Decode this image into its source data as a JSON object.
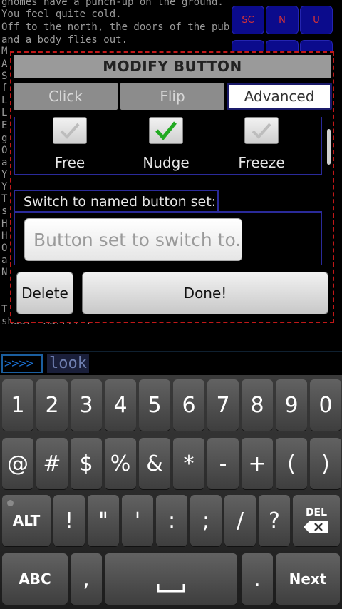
{
  "terminal": {
    "lines": [
      "gnomes have a punch-up on the ground.",
      "You feel quite cold.",
      "Off to the north, the doors of the pub open",
      "and a body flies out.",
      "M",
      "A",
      "S",
      "f",
      "L",
      "L",
      "E",
      "g",
      "O",
      "a",
      "Y",
      "Y",
      "T",
      "s",
      "H",
      "H",
      "O",
      "a",
      "N",
      "",
      "T",
      "shout \"Aarrr!\"."
    ]
  },
  "mini_buttons": {
    "sc": "SC",
    "n": "N",
    "u": "U"
  },
  "dialog": {
    "title": "MODIFY BUTTON",
    "tabs": [
      {
        "label": "Click",
        "active": false
      },
      {
        "label": "Flip",
        "active": false
      },
      {
        "label": "Advanced",
        "active": true
      }
    ],
    "checkboxes": [
      {
        "label": "Free",
        "checked": false
      },
      {
        "label": "Nudge",
        "checked": true
      },
      {
        "label": "Freeze",
        "checked": false
      }
    ],
    "switch_label": "Switch to named button set:",
    "named_set_placeholder": "Button set to switch to.",
    "delete_label": "Delete",
    "done_label": "Done!"
  },
  "command": {
    "prompt": ">>>>",
    "text": "look"
  },
  "keyboard": {
    "row1": [
      "1",
      "2",
      "3",
      "4",
      "5",
      "6",
      "7",
      "8",
      "9",
      "0"
    ],
    "row2": [
      "@",
      "#",
      "$",
      "%",
      "&",
      "*",
      "-",
      "+",
      "(",
      ")"
    ],
    "row3": [
      "!",
      "\"",
      "'",
      ":",
      ";",
      "/",
      "?"
    ],
    "alt_label": "ALT",
    "del_label": "DEL",
    "abc_label": "ABC",
    "comma": ",",
    "period": ".",
    "next_label": "Next"
  },
  "colors": {
    "dialog_border": "#c01818",
    "frame_blue": "#2a2a9a",
    "check_green": "#22aa22"
  }
}
